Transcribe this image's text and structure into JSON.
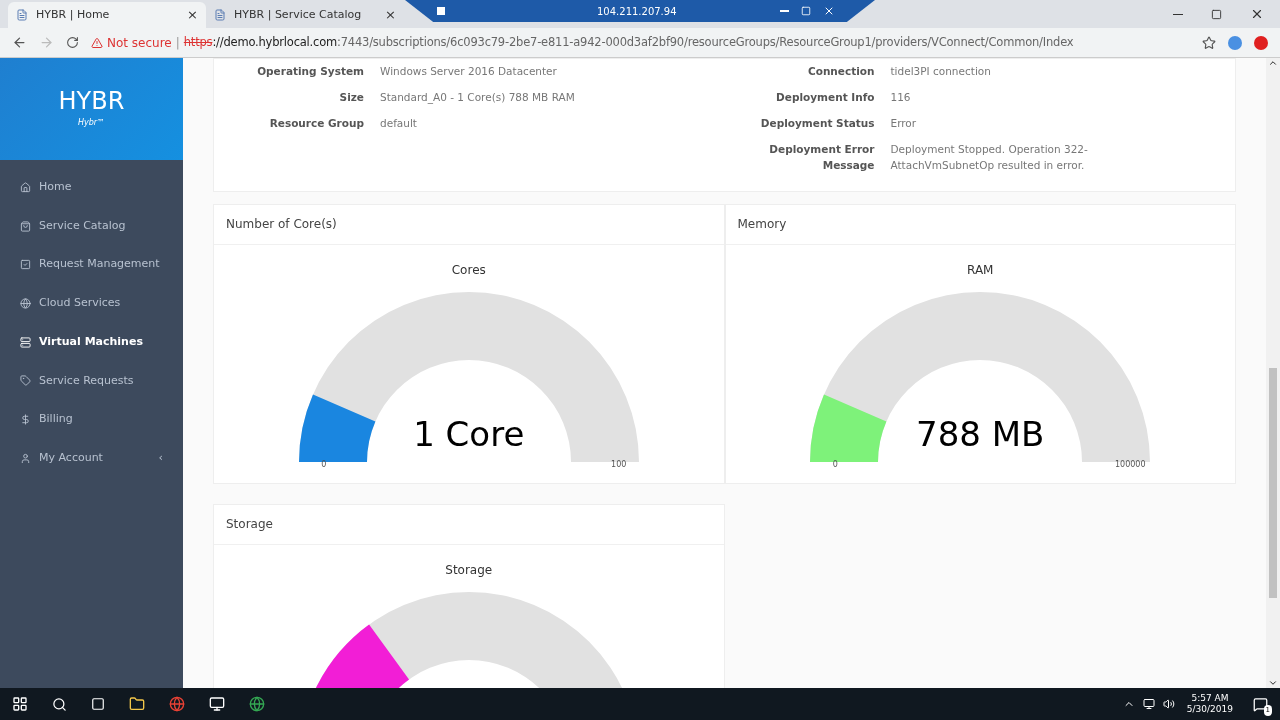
{
  "browser": {
    "tabs": [
      {
        "title": "HYBR | Home",
        "selected": true,
        "close": "×"
      },
      {
        "title": "HYBR | Service Catalog",
        "selected": false,
        "close": "×"
      }
    ],
    "remote_bar": {
      "address": "104.211.207.94"
    },
    "address_bar": {
      "security": "Not secure",
      "separator": "|",
      "scheme": "https",
      "host": "://demo.hybrlocal.com",
      "path": ":7443/subscriptions/6c093c79-2be7-e811-a942-000d3af2bf90/resourceGroups/ResourceGroup1/providers/VConnect/Common/Index"
    }
  },
  "sidebar": {
    "logo": "HYBR",
    "tagline": "Hybr™",
    "items": [
      {
        "label": "Home",
        "selected": false
      },
      {
        "label": "Service Catalog",
        "selected": false
      },
      {
        "label": "Request Management",
        "selected": false
      },
      {
        "label": "Cloud Services",
        "selected": false
      },
      {
        "label": "Virtual Machines",
        "selected": true
      },
      {
        "label": "Service Requests",
        "selected": false
      },
      {
        "label": "Billing",
        "selected": false
      },
      {
        "label": "My Account",
        "selected": false,
        "caret": "‹"
      }
    ]
  },
  "details": {
    "left": [
      {
        "label": "Operating System",
        "value": "Windows Server 2016 Datacenter"
      },
      {
        "label": "Size",
        "value": "Standard_A0 - 1 Core(s) 788 MB RAM"
      },
      {
        "label": "Resource Group",
        "value": "default"
      }
    ],
    "right": [
      {
        "label": "Connection",
        "value": "tidel3PI connection"
      },
      {
        "label": "Deployment Info",
        "value": "116"
      },
      {
        "label": "Deployment Status",
        "value": "Error"
      },
      {
        "label": "Deployment Error Message",
        "value": "Deployment Stopped. Operation 322-AttachVmSubnetOp resulted in error."
      }
    ]
  },
  "gauges": [
    {
      "panel": "Number of Core(s)",
      "title": "Cores",
      "value": "1 Core",
      "min": "0",
      "max": "100",
      "color": "#1a86e0"
    },
    {
      "panel": "Memory",
      "title": "RAM",
      "value": "788 MB",
      "min": "0",
      "max": "100000",
      "color": "#7ef27a"
    },
    {
      "panel": "Storage",
      "title": "Storage",
      "color": "#f21ed6"
    }
  ],
  "taskbar": {
    "time": "5:57 AM",
    "date": "5/30/2019",
    "notifications": "1"
  }
}
